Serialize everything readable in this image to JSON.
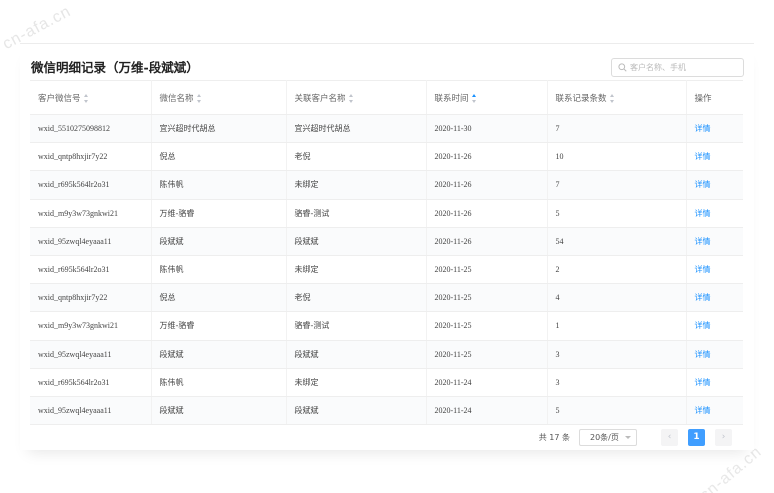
{
  "watermark": {
    "top_left": "cn-afa.cn",
    "bottom_right": "cn-afa.cn"
  },
  "header": {
    "title": "微信明细记录（万维-段斌斌）",
    "search_placeholder": "客户名称、手机"
  },
  "table": {
    "columns": [
      {
        "label": "客户微信号",
        "sortable": true,
        "active": false
      },
      {
        "label": "微信名称",
        "sortable": true,
        "active": false
      },
      {
        "label": "关联客户名称",
        "sortable": true,
        "active": false
      },
      {
        "label": "联系时间",
        "sortable": true,
        "active": true
      },
      {
        "label": "联系记录条数",
        "sortable": true,
        "active": false
      },
      {
        "label": "操作",
        "sortable": false,
        "active": false
      }
    ],
    "rows": [
      [
        "wxid_5510275098812",
        "宜兴超时代胡总",
        "宜兴超时代胡总",
        "2020-11-30",
        "7",
        "详情"
      ],
      [
        "wxid_qntp8hxjir7y22",
        "倪总",
        "老倪",
        "2020-11-26",
        "10",
        "详情"
      ],
      [
        "wxid_r695k564lr2o31",
        "陈伟帆",
        "未绑定",
        "2020-11-26",
        "7",
        "详情"
      ],
      [
        "wxid_m9y3w73gnkwi21",
        "万维-骆睿",
        "骆睿-测试",
        "2020-11-26",
        "5",
        "详情"
      ],
      [
        "wxid_95zwql4eyaaa11",
        "段斌斌",
        "段斌斌",
        "2020-11-26",
        "54",
        "详情"
      ],
      [
        "wxid_r695k564lr2o31",
        "陈伟帆",
        "未绑定",
        "2020-11-25",
        "2",
        "详情"
      ],
      [
        "wxid_qntp8hxjir7y22",
        "倪总",
        "老倪",
        "2020-11-25",
        "4",
        "详情"
      ],
      [
        "wxid_m9y3w73gnkwi21",
        "万维-骆睿",
        "骆睿-测试",
        "2020-11-25",
        "1",
        "详情"
      ],
      [
        "wxid_95zwql4eyaaa11",
        "段斌斌",
        "段斌斌",
        "2020-11-25",
        "3",
        "详情"
      ],
      [
        "wxid_r695k564lr2o31",
        "陈伟帆",
        "未绑定",
        "2020-11-24",
        "3",
        "详情"
      ],
      [
        "wxid_95zwql4eyaaa11",
        "段斌斌",
        "段斌斌",
        "2020-11-24",
        "5",
        "详情"
      ]
    ]
  },
  "pagination": {
    "total_label": "共 17 条",
    "page_size": "20条/页",
    "prev": "‹",
    "current": "1",
    "next": "›"
  },
  "colors": {
    "accent": "#1890ff",
    "current_page": "#409eff"
  }
}
